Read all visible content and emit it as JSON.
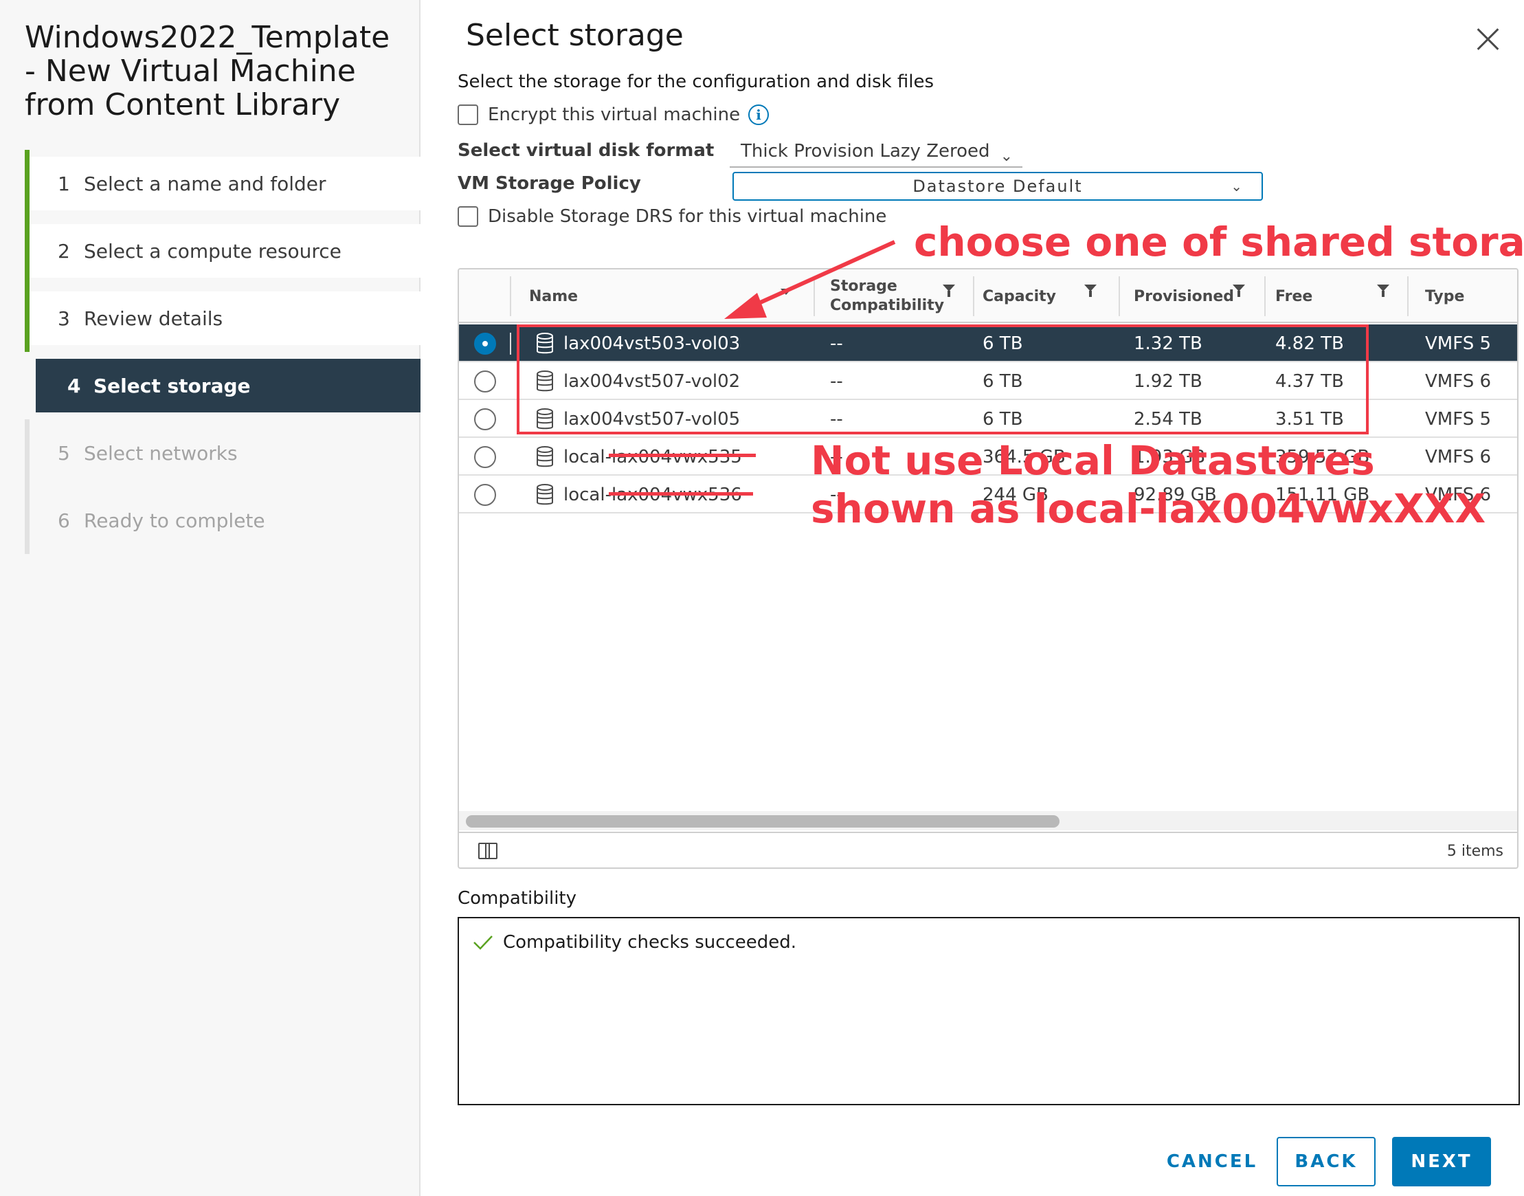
{
  "wizard": {
    "title_line1": "Windows2022_Template",
    "title_line2": "- New Virtual Machine",
    "title_line3": "from Content Library",
    "steps": [
      {
        "num": "1",
        "label": "Select a name and folder"
      },
      {
        "num": "2",
        "label": "Select a compute resource"
      },
      {
        "num": "3",
        "label": "Review details"
      },
      {
        "num": "4",
        "label": "Select storage"
      },
      {
        "num": "5",
        "label": "Select networks"
      },
      {
        "num": "6",
        "label": "Ready to complete"
      }
    ]
  },
  "main": {
    "title": "Select storage",
    "subtitle": "Select the storage for the configuration and disk files",
    "encrypt_label": "Encrypt this virtual machine",
    "disk_format_label": "Select virtual disk format",
    "disk_format_value": "Thick Provision Lazy Zeroed",
    "storage_policy_label": "VM Storage Policy",
    "storage_policy_value": "Datastore Default",
    "disable_drs_label": "Disable Storage DRS for this virtual machine"
  },
  "grid": {
    "columns": {
      "name": "Name",
      "compat_line1": "Storage",
      "compat_line2": "Compatibility",
      "capacity": "Capacity",
      "provisioned": "Provisioned",
      "free": "Free",
      "type": "Type"
    },
    "rows": [
      {
        "name": "lax004vst503-vol03",
        "compat": "--",
        "capacity": "6 TB",
        "provisioned": "1.32 TB",
        "free": "4.82 TB",
        "type": "VMFS 5",
        "selected": true
      },
      {
        "name": "lax004vst507-vol02",
        "compat": "--",
        "capacity": "6 TB",
        "provisioned": "1.92 TB",
        "free": "4.37 TB",
        "type": "VMFS 6",
        "selected": false
      },
      {
        "name": "lax004vst507-vol05",
        "compat": "--",
        "capacity": "6 TB",
        "provisioned": "2.54 TB",
        "free": "3.51 TB",
        "type": "VMFS 5",
        "selected": false
      },
      {
        "name": "local-lax004vwx535",
        "compat": "--",
        "capacity": "364.5 GB",
        "provisioned": "1.93 GB",
        "free": "359.57 GB",
        "type": "VMFS 6",
        "selected": false
      },
      {
        "name": "local-lax004vwx536",
        "compat": "--",
        "capacity": "244 GB",
        "provisioned": "92.89 GB",
        "free": "151.11 GB",
        "type": "VMFS 6",
        "selected": false
      }
    ],
    "items_count": "5 items"
  },
  "compatibility": {
    "label": "Compatibility",
    "message": "Compatibility checks succeeded."
  },
  "buttons": {
    "cancel": "CANCEL",
    "back": "BACK",
    "next": "NEXT"
  },
  "annotations": {
    "shared": "choose one of shared storage",
    "local_line1": "Not use Local Datastores",
    "local_line2": "shown as local-lax004vwxXXX"
  },
  "colors": {
    "accent_blue": "#0079b8",
    "selected_row": "#293d4c",
    "completed_step": "#5aa220",
    "annotation_red": "#f03a47"
  },
  "icons": [
    "close-icon",
    "info-icon",
    "chevron-down-icon",
    "filter-icon",
    "sort-icon",
    "database-icon",
    "column-toggle-icon",
    "check-icon"
  ]
}
